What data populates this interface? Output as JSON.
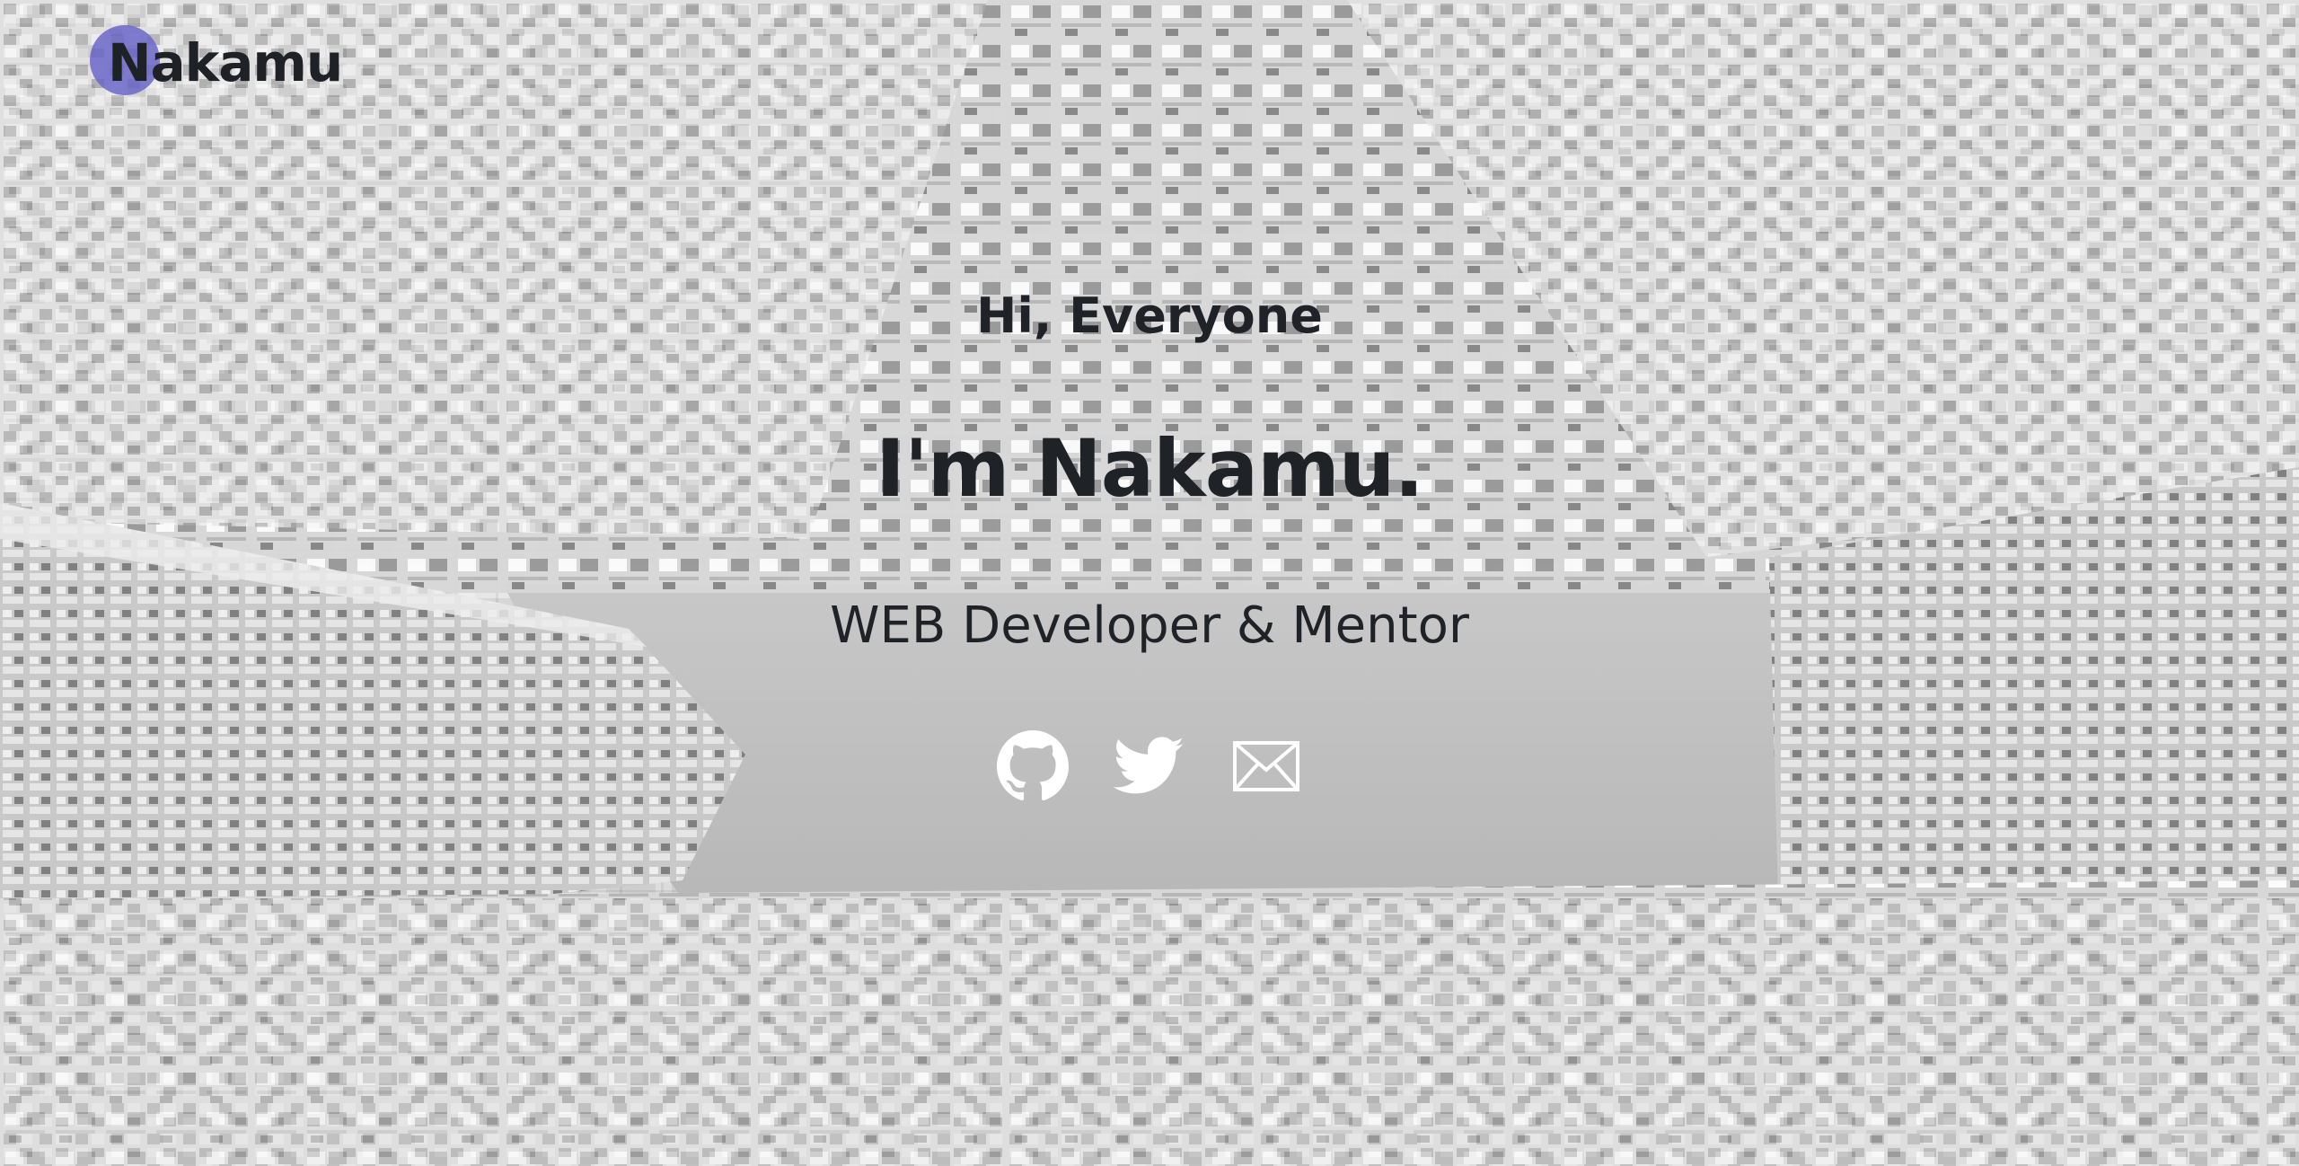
{
  "brand": {
    "name": "Nakamu",
    "accent_color": "#6b67c9"
  },
  "hero": {
    "greeting": "Hi, Everyone",
    "headline": "I'm Nakamu.",
    "subtitle": "WEB Developer & Mentor"
  },
  "social_links": [
    {
      "icon": "github-icon",
      "label": "GitHub"
    },
    {
      "icon": "twitter-icon",
      "label": "Twitter"
    },
    {
      "icon": "mail-icon",
      "label": "Email"
    }
  ],
  "colors": {
    "text": "#1f2328",
    "icons": "#ffffff"
  }
}
